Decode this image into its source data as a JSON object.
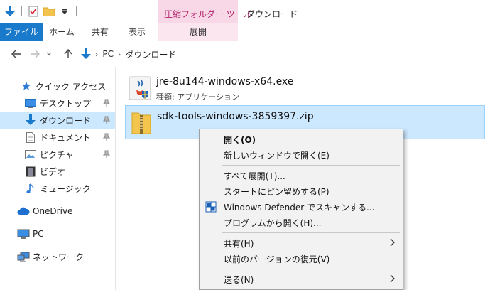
{
  "titlebar": {
    "contextual_group": "圧縮フォルダー ツール",
    "window_title": "ダウンロード"
  },
  "ribbon": {
    "tabs": [
      {
        "label": "ファイル"
      },
      {
        "label": "ホーム"
      },
      {
        "label": "共有"
      },
      {
        "label": "表示"
      },
      {
        "label": "展開"
      }
    ]
  },
  "address": {
    "crumbs": [
      "PC",
      "ダウンロード"
    ]
  },
  "navpane": {
    "items": [
      {
        "label": "クイック アクセス",
        "icon": "star-icon"
      },
      {
        "label": "デスクトップ",
        "icon": "desktop-icon",
        "pinned": true
      },
      {
        "label": "ダウンロード",
        "icon": "download-icon",
        "pinned": true,
        "selected": true
      },
      {
        "label": "ドキュメント",
        "icon": "document-icon",
        "pinned": true
      },
      {
        "label": "ピクチャ",
        "icon": "pictures-icon",
        "pinned": true
      },
      {
        "label": "ビデオ",
        "icon": "video-icon"
      },
      {
        "label": "ミュージック",
        "icon": "music-icon"
      },
      {
        "label": "OneDrive",
        "icon": "cloud-icon"
      },
      {
        "label": "PC",
        "icon": "computer-icon"
      },
      {
        "label": "ネットワーク",
        "icon": "network-icon"
      }
    ]
  },
  "files": [
    {
      "name": "jre-8u144-windows-x64.exe",
      "subtitle": "種類: アプリケーション",
      "icon": "java-installer-icon"
    },
    {
      "name": "sdk-tools-windows-3859397.zip",
      "subtitle": "",
      "icon": "zip-folder-icon",
      "selected": true
    }
  ],
  "context_menu": {
    "items": [
      {
        "label": "開く(O)",
        "bold": true
      },
      {
        "label": "新しいウィンドウで開く(E)"
      },
      {
        "label": "すべて展開(T)..."
      },
      {
        "label": "スタートにピン留めする(P)"
      },
      {
        "label": "Windows Defender でスキャンする...",
        "icon": "defender-shield-icon"
      },
      {
        "label": "プログラムから開く(H)..."
      },
      {
        "label": "共有(H)",
        "submenu": true
      },
      {
        "label": "以前のバージョンの復元(V)"
      },
      {
        "label": "送る(N)",
        "submenu": true
      }
    ]
  },
  "colors": {
    "accent": "#1979ca",
    "selection": "#cce8ff",
    "contextual_tab": "#f8d7e6"
  }
}
